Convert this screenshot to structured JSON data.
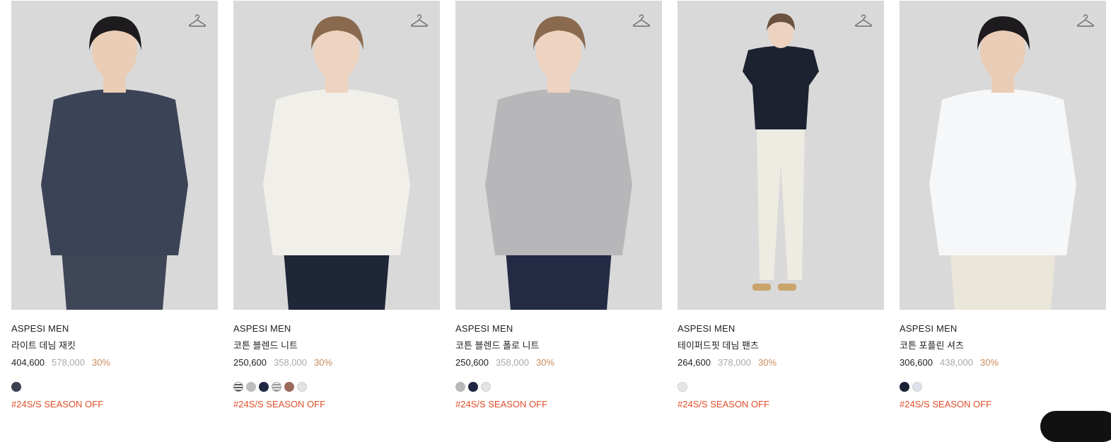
{
  "products": [
    {
      "brand": "ASPESI MEN",
      "name": "라이트 데님 재킷",
      "price": "404,600",
      "original_price": "578,000",
      "discount": "30%",
      "tag": "#24S/S SEASON OFF",
      "colors": [
        "#3a4151"
      ],
      "outfit": {
        "top": "#3b4356",
        "bottom": "#3f4658",
        "skin": "#e9cdb6",
        "hair": "#1d1b1d"
      }
    },
    {
      "brand": "ASPESI MEN",
      "name": "코튼 블렌드 니트",
      "price": "250,600",
      "original_price": "358,000",
      "discount": "30%",
      "tag": "#24S/S SEASON OFF",
      "colors": [
        "stripe",
        "#bdbdbd",
        "#1f2743",
        "stripe-grey",
        "#9b6b5e",
        "#e3e3e3"
      ],
      "outfit": {
        "top": "#f1efe9",
        "bottom": "#1e2638",
        "skin": "#edd3c0",
        "hair": "#8a6a4e"
      }
    },
    {
      "brand": "ASPESI MEN",
      "name": "코튼 블렌드 폴로 니트",
      "price": "250,600",
      "original_price": "358,000",
      "discount": "30%",
      "tag": "#24S/S SEASON OFF",
      "colors": [
        "#b8b8b8",
        "#1f2743",
        "#e3e3e3"
      ],
      "outfit": {
        "top": "#b7b7b9",
        "bottom": "#232b45",
        "skin": "#edd3c0",
        "hair": "#8a6a4e"
      }
    },
    {
      "brand": "ASPESI MEN",
      "name": "테이퍼드핏 데님 팬츠",
      "price": "264,600",
      "original_price": "378,000",
      "discount": "30%",
      "tag": "#24S/S SEASON OFF",
      "colors": [
        "#e6e6e6"
      ],
      "outfit": {
        "top": "#1c2230",
        "bottom": "#eeebe2",
        "skin": "#ecd2bf",
        "hair": "#6b5140"
      }
    },
    {
      "brand": "ASPESI MEN",
      "name": "코튼 포플린 셔츠",
      "price": "306,600",
      "original_price": "438,000",
      "discount": "30%",
      "tag": "#24S/S SEASON OFF",
      "colors": [
        "#1b2236",
        "#dde1ea"
      ],
      "outfit": {
        "top": "#f6f7f9",
        "bottom": "#ebe6da",
        "skin": "#e9cdb6",
        "hair": "#1d1b1d"
      }
    }
  ]
}
